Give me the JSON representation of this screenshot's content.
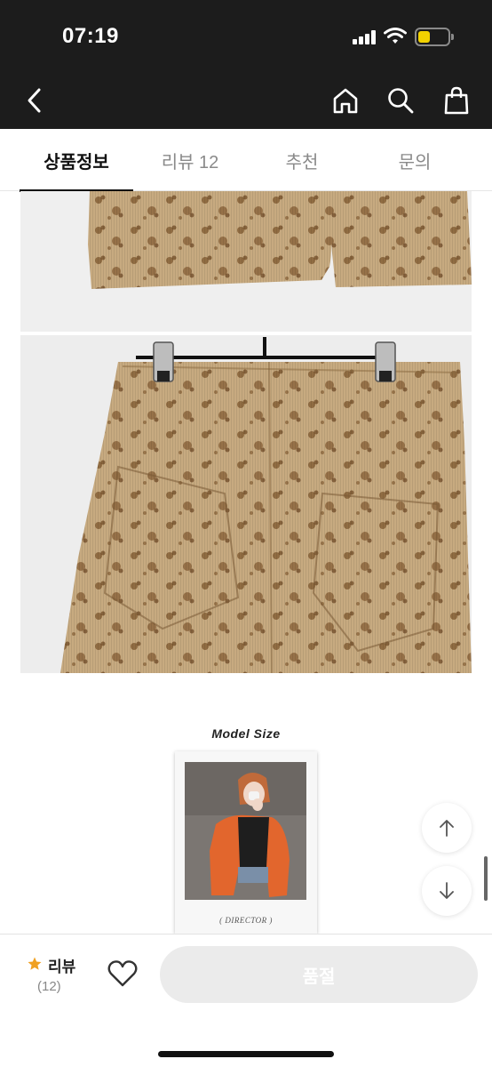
{
  "status_bar": {
    "time": "07:19"
  },
  "tabs": [
    {
      "label": "상품정보"
    },
    {
      "label": "리뷰 12"
    },
    {
      "label": "추천"
    },
    {
      "label": "문의"
    }
  ],
  "model_section": {
    "title": "Model Size",
    "caption": "( DIRECTOR )"
  },
  "bottom_bar": {
    "review_label": "리뷰",
    "review_count": "(12)",
    "soldout_label": "품절"
  },
  "colors": {
    "header_bg": "#1c1c1c",
    "star": "#f0a020",
    "soldout_bg": "#ebebeb",
    "battery": "#f2d200"
  },
  "icons": [
    "back-icon",
    "home-icon",
    "search-icon",
    "shopping-bag-icon",
    "star-icon",
    "heart-icon",
    "arrow-up-icon",
    "arrow-down-icon"
  ]
}
